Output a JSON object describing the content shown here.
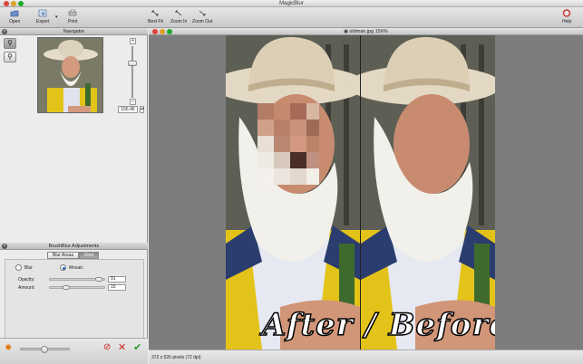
{
  "window": {
    "title": "MagicBlur"
  },
  "toolbar": {
    "open_label": "Open",
    "export_label": "Export",
    "print_label": "Print",
    "best_fit_label": "Best Fit",
    "zoom_in_label": "Zoom In",
    "zoom_out_label": "Zoom Out",
    "help_label": "Help"
  },
  "navigator": {
    "title": "Navigator",
    "zoom_value": "156.46"
  },
  "adjustments": {
    "title": "BrushBlur Adjustments",
    "tabs": [
      "Blur Areas",
      "Kind"
    ],
    "active_tab": 1,
    "modes": [
      "Blur",
      "Mosaic"
    ],
    "selected_mode": "Mosaic",
    "opacity_label": "Opacity:",
    "opacity_value": "91",
    "amount_label": "Amount:",
    "amount_value": "15"
  },
  "document": {
    "title": "oldman.jpg 156%",
    "status": "372 x 526 pixels (72 dpi)",
    "overlay_caption": "After / Before"
  }
}
